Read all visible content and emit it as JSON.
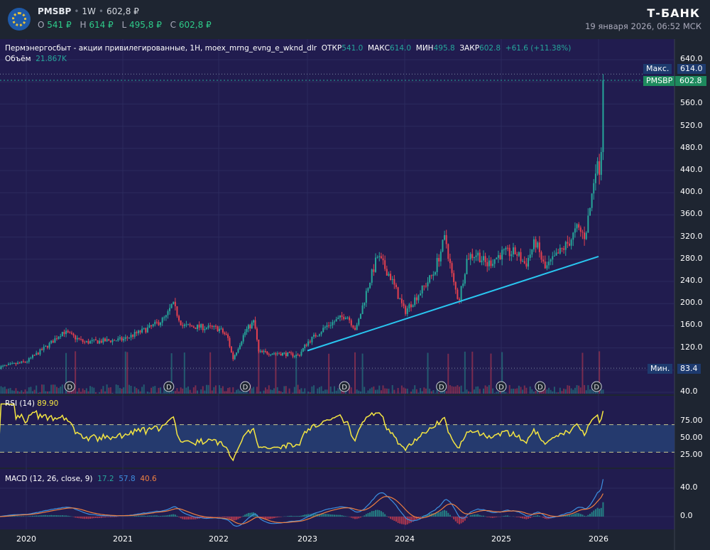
{
  "header": {
    "symbol": "PMSBP",
    "interval": "1W",
    "price": "602,8 ₽",
    "ohlc": [
      {
        "k": "O",
        "v": "541 ₽"
      },
      {
        "k": "H",
        "v": "614 ₽"
      },
      {
        "k": "L",
        "v": "495,8 ₽"
      },
      {
        "k": "C",
        "v": "602,8 ₽"
      }
    ],
    "brand": "Т-БАНК",
    "datetime": "19 января 2026, 06:52 МСК"
  },
  "legend": {
    "title": "Пермэнергосбыт - акции привилегированные, 1H, moex_mrng_evng_e_wknd_dlr",
    "open_label": "ОТКР",
    "open": "541.0",
    "high_label": "МАКС",
    "high": "614.0",
    "low_label": "МИН",
    "low": "495.8",
    "close_label": "ЗАКР",
    "close": "602.8",
    "change": "+61.6 (+11.38%)",
    "volume_label": "Объём",
    "volume": "21.867K"
  },
  "tags": {
    "max_label": "Макс.",
    "max": "614.0",
    "last_label": "PMSBP",
    "last": "602.8",
    "min_label": "Мин.",
    "min": "83.4"
  },
  "rsi": {
    "label": "RSI (14)",
    "value": "89.90",
    "ticks": [
      "75.00",
      "50.00",
      "25.00"
    ]
  },
  "macd": {
    "label": "MACD (12, 26, close, 9)",
    "hist": "17.2",
    "macd": "57.8",
    "signal": "40.6",
    "ticks": [
      "40.0",
      "0.0"
    ]
  },
  "dividend_marker": "D",
  "colors": {
    "up": "#26a69a",
    "down": "#e5414f",
    "trend": "#29c6f0",
    "rsi": "#f5e642",
    "macd": "#3d8fe0",
    "signal": "#f08040"
  },
  "chart_data": {
    "type": "candlestick",
    "interval": "1W",
    "ylim": [
      40,
      660
    ],
    "y_ticks": [
      "640.0",
      "600.0",
      "560.0",
      "520.0",
      "480.0",
      "440.0",
      "400.0",
      "360.0",
      "320.0",
      "280.0",
      "240.0",
      "200.0",
      "160.0",
      "120.0",
      "80.0",
      "40.0"
    ],
    "x_ticks": [
      "2020",
      "2021",
      "2022",
      "2023",
      "2024",
      "2025",
      "2026"
    ],
    "close_keypoints": [
      [
        2019.72,
        85
      ],
      [
        2020.0,
        95
      ],
      [
        2020.25,
        128
      ],
      [
        2020.38,
        150
      ],
      [
        2020.6,
        130
      ],
      [
        2021.0,
        135
      ],
      [
        2021.3,
        158
      ],
      [
        2021.45,
        175
      ],
      [
        2021.52,
        200
      ],
      [
        2021.62,
        160
      ],
      [
        2022.0,
        155
      ],
      [
        2022.1,
        140
      ],
      [
        2022.16,
        100
      ],
      [
        2022.3,
        150
      ],
      [
        2022.4,
        168
      ],
      [
        2022.45,
        112
      ],
      [
        2022.7,
        110
      ],
      [
        2022.9,
        106
      ],
      [
        2023.0,
        130
      ],
      [
        2023.2,
        160
      ],
      [
        2023.4,
        180
      ],
      [
        2023.5,
        152
      ],
      [
        2023.62,
        230
      ],
      [
        2023.72,
        285
      ],
      [
        2023.85,
        250
      ],
      [
        2024.0,
        185
      ],
      [
        2024.2,
        230
      ],
      [
        2024.3,
        255
      ],
      [
        2024.42,
        320
      ],
      [
        2024.5,
        240
      ],
      [
        2024.56,
        205
      ],
      [
        2024.65,
        285
      ],
      [
        2024.75,
        290
      ],
      [
        2024.85,
        270
      ],
      [
        2025.0,
        290
      ],
      [
        2025.15,
        292
      ],
      [
        2025.25,
        270
      ],
      [
        2025.35,
        312
      ],
      [
        2025.45,
        262
      ],
      [
        2025.6,
        292
      ],
      [
        2025.7,
        312
      ],
      [
        2025.78,
        335
      ],
      [
        2025.86,
        322
      ],
      [
        2025.92,
        380
      ],
      [
        2025.97,
        450
      ],
      [
        2026.0,
        440
      ],
      [
        2026.02,
        455
      ],
      [
        2026.04,
        530
      ],
      [
        2026.05,
        602.8
      ]
    ],
    "trendline": [
      [
        2023.0,
        115
      ],
      [
        2026.0,
        285
      ]
    ],
    "dividends": [
      2020.45,
      2021.48,
      2022.3,
      2023.38,
      2024.38,
      2025.0,
      2025.4,
      2025.98
    ]
  }
}
